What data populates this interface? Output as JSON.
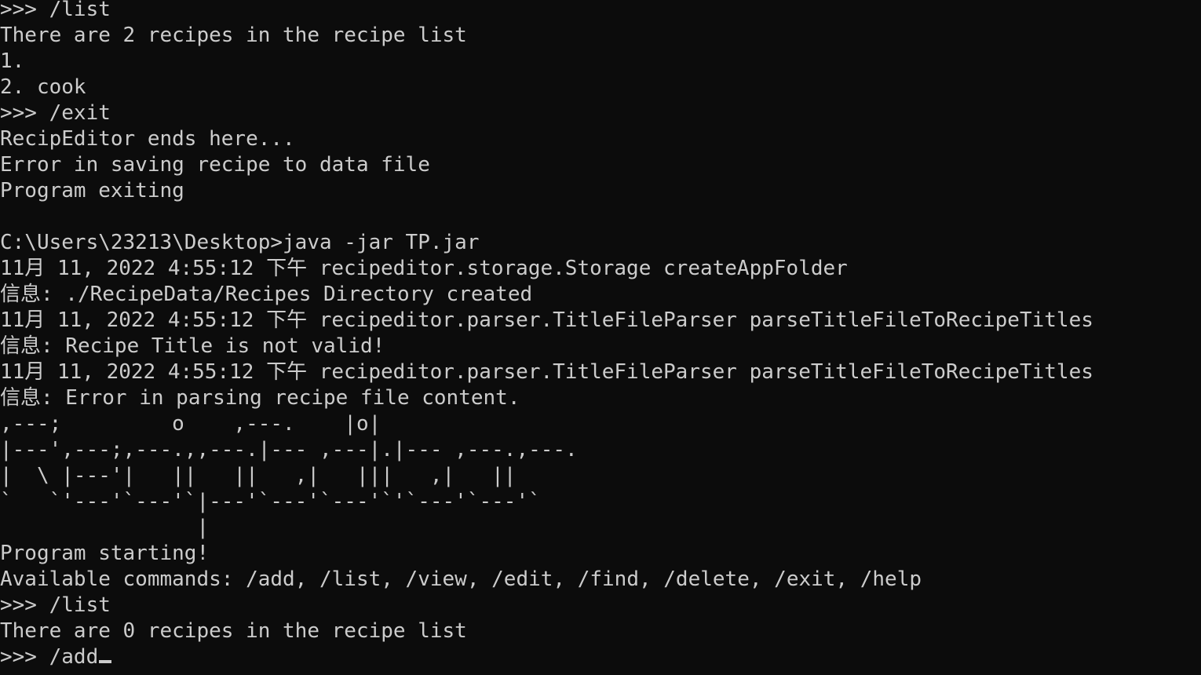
{
  "terminal": {
    "lines": [
      ">>> /list",
      "There are 2 recipes in the recipe list",
      "1.",
      "2. cook",
      ">>> /exit",
      "RecipEditor ends here...",
      "Error in saving recipe to data file",
      "Program exiting",
      "",
      "C:\\Users\\23213\\Desktop>java -jar TP.jar",
      "11月 11, 2022 4:55:12 下午 recipeditor.storage.Storage createAppFolder",
      "信息: ./RecipeData/Recipes Directory created",
      "11月 11, 2022 4:55:12 下午 recipeditor.parser.TitleFileParser parseTitleFileToRecipeTitles",
      "信息: Recipe Title is not valid!",
      "11月 11, 2022 4:55:12 下午 recipeditor.parser.TitleFileParser parseTitleFileToRecipeTitles",
      "信息: Error in parsing recipe file content.",
      ",---;         o    ,---.    |o|",
      "|---',---;,---.,,---.|--- ,---|.|--- ,---.,---.",
      "|  \\ |---'|   ||   ||   ,|   |||   ,|   ||",
      "`   `'---'`---'`|---'`---'`---'`'`---'`---'`",
      "                |",
      "Program starting!",
      "Available commands: /add, /list, /view, /edit, /find, /delete, /exit, /help",
      ">>> /list",
      "There are 0 recipes in the recipe list"
    ],
    "current_input": ">>> /add"
  }
}
